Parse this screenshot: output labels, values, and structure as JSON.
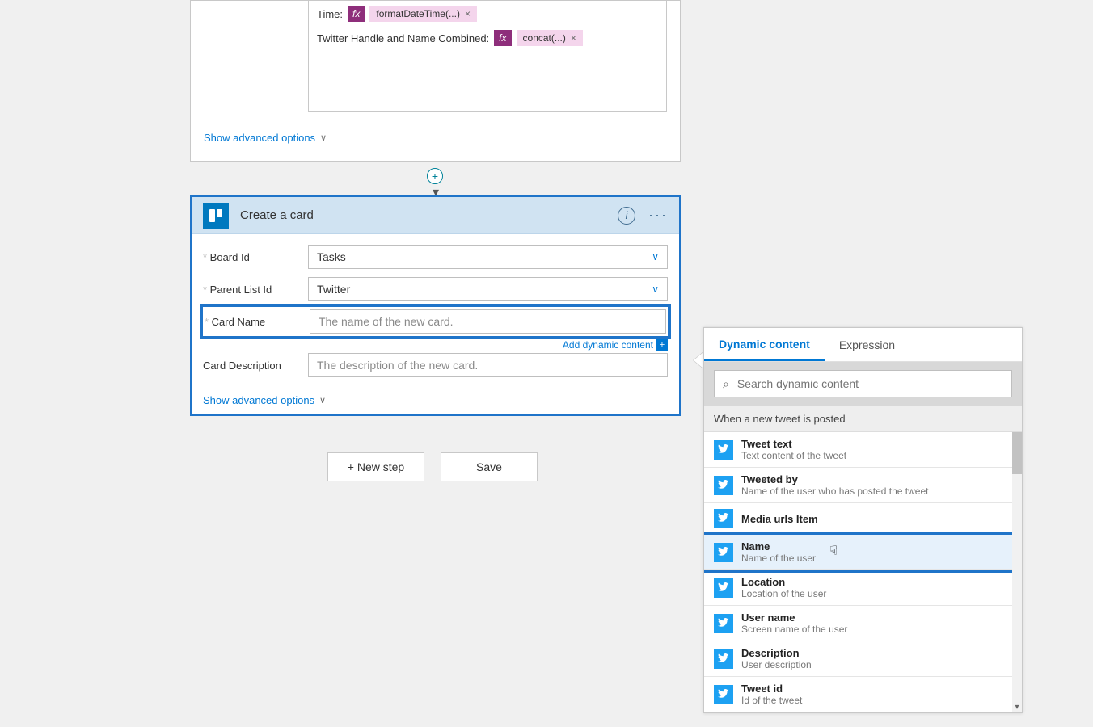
{
  "top_card": {
    "fields": [
      {
        "label": "Time:",
        "fx": "fx",
        "token": "formatDateTime(...)"
      },
      {
        "label": "Twitter Handle and Name Combined:",
        "fx": "fx",
        "token": "concat(...)"
      }
    ],
    "show_advanced": "Show advanced options"
  },
  "action": {
    "title": "Create a card",
    "fields": {
      "board_id": {
        "label": "Board Id",
        "value": "Tasks",
        "type": "dropdown"
      },
      "parent_list": {
        "label": "Parent List Id",
        "value": "Twitter",
        "type": "dropdown"
      },
      "card_name": {
        "label": "Card Name",
        "placeholder": "The name of the new card."
      },
      "card_desc": {
        "label": "Card Description",
        "placeholder": "The description of the new card."
      }
    },
    "add_dynamic": "Add dynamic content",
    "show_advanced": "Show advanced options"
  },
  "buttons": {
    "new_step": "+ New step",
    "save": "Save"
  },
  "dc_panel": {
    "tabs": {
      "dynamic": "Dynamic content",
      "expression": "Expression"
    },
    "search_placeholder": "Search dynamic content",
    "section": "When a new tweet is posted",
    "items": [
      {
        "title": "Tweet text",
        "desc": "Text content of the tweet"
      },
      {
        "title": "Tweeted by",
        "desc": "Name of the user who has posted the tweet"
      },
      {
        "title": "Media urls Item",
        "desc": ""
      },
      {
        "title": "Name",
        "desc": "Name of the user",
        "highlight": true
      },
      {
        "title": "Location",
        "desc": "Location of the user"
      },
      {
        "title": "User name",
        "desc": "Screen name of the user"
      },
      {
        "title": "Description",
        "desc": "User description"
      },
      {
        "title": "Tweet id",
        "desc": "Id of the tweet"
      }
    ]
  }
}
